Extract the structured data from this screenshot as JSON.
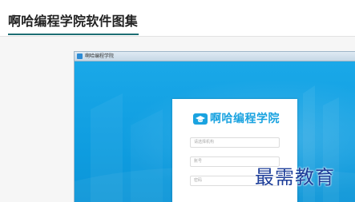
{
  "page": {
    "title": "啊哈编程学院软件图集"
  },
  "window": {
    "title": "啊哈编程学院",
    "app_icon": "window-app-icon"
  },
  "login": {
    "brand": "啊哈编程学院",
    "brand_icon": "graduation-cap-icon",
    "brand_color": "#1aa3e0",
    "fields": [
      {
        "placeholder": "请选择机构"
      },
      {
        "placeholder": "账号"
      },
      {
        "placeholder": "密码"
      }
    ]
  },
  "watermark": {
    "text": "最需教育"
  },
  "colors": {
    "accent": "#1d6d73",
    "login_background": "#14a2e2"
  }
}
